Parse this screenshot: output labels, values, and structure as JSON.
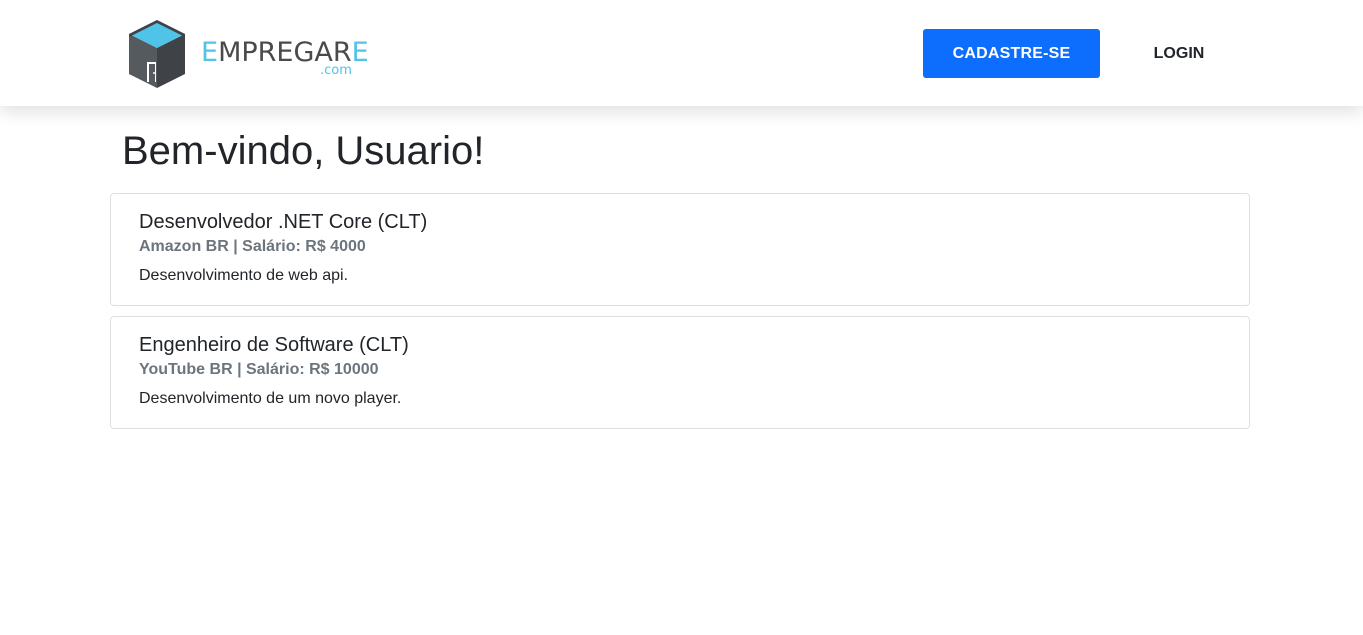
{
  "navbar": {
    "brand": {
      "logo_icon": "box-door-icon",
      "name_first_letter": "E",
      "name_middle": "MPREGAR",
      "name_last_letter": "E",
      "suffix": ".com"
    },
    "signup_label": "CADASTRE-SE",
    "login_label": "LOGIN"
  },
  "main": {
    "greeting": "Bem-vindo, Usuario!",
    "jobs": [
      {
        "title": "Desenvolvedor .NET Core (CLT)",
        "company": "Amazon BR",
        "salary_label": "Salário: R$ 4000",
        "meta": "Amazon BR | Salário: R$ 4000",
        "description": "Desenvolvimento de web api."
      },
      {
        "title": "Engenheiro de Software (CLT)",
        "company": "YouTube BR",
        "salary_label": "Salário: R$ 10000",
        "meta": "YouTube BR | Salário: R$ 10000",
        "description": "Desenvolvimento de um novo player."
      }
    ]
  },
  "colors": {
    "primary": "#0d6efd",
    "brand_accent": "#4fc3e8",
    "brand_dark": "#4a4a4a",
    "muted_text": "#6c757d",
    "card_border": "#dcdfe3"
  }
}
